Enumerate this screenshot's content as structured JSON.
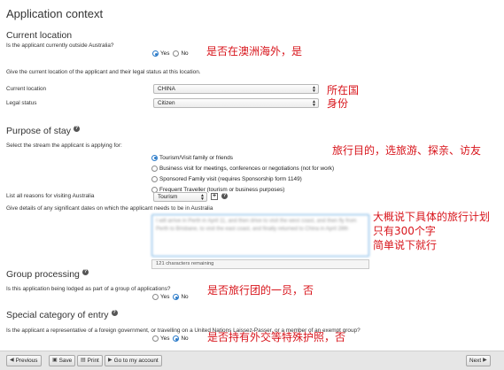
{
  "heading": "Application context",
  "current_location": {
    "section_title": "Current location",
    "question": "Is the applicant currently outside Australia?",
    "options": [
      "Yes",
      "No"
    ],
    "selected": "Yes",
    "annotation": "是否在澳洲海外，是",
    "instruction": "Give the current location of the applicant and their legal status at this location.",
    "location_label": "Current location",
    "location_value": "CHINA",
    "legal_status_label": "Legal status",
    "legal_status_value": "Citizen",
    "annotation_location_line1": "所在国",
    "annotation_location_line2": "身份"
  },
  "purpose_of_stay": {
    "section_title": "Purpose of stay",
    "question": "Select the stream the applicant is applying for:",
    "streams": [
      "Tourism/Visit family or friends",
      "Business visit for meetings, conferences or negotiations (not for work)",
      "Sponsored Family visit (requires Sponsorship form 1149)",
      "Frequent Traveller (tourism or business purposes)"
    ],
    "selected_stream": 0,
    "annotation_stream": "旅行目的，选旅游、探亲、访友",
    "reasons_label": "List all reasons for visiting Australia",
    "reasons_value": "Tourism",
    "dates_label": "Give details of any significant dates on which the applicant needs to be in Australia",
    "dates_text": "I will arrive in Perth in April 11, and then drive to visit the west coast, and then fly from Perth to Brisbane, to visit the east coast, and finally returned to China in April 28th",
    "remaining": "121 characters remaining",
    "annotation_plan_line1": "大概说下具体的旅行计划",
    "annotation_plan_line2": "只有300个字",
    "annotation_plan_line3": "简单说下就行"
  },
  "group_processing": {
    "section_title": "Group processing",
    "question": "Is this application being lodged as part of a group of applications?",
    "options": [
      "Yes",
      "No"
    ],
    "selected": "No",
    "annotation": "是否旅行团的一员，否"
  },
  "special_category": {
    "section_title": "Special category of entry",
    "question": "Is the applicant a representative of a foreign government, or travelling on a United Nations Laissez-Passer, or a member of an exempt group?",
    "options": [
      "Yes",
      "No"
    ],
    "selected": "No",
    "annotation": "是否持有外交等特殊护照，否"
  },
  "footer": {
    "previous": "Previous",
    "save": "Save",
    "print": "Print",
    "account": "Go to my account",
    "next": "Next"
  },
  "colors": {
    "annotation": "#d8141b",
    "radio_selected": "#2b7bc9",
    "textarea_border": "#63a8e0"
  },
  "icons": [
    "help-icon",
    "dropdown-arrow-icon",
    "chevron-left-icon",
    "chevron-right-icon",
    "save-icon",
    "print-icon"
  ]
}
